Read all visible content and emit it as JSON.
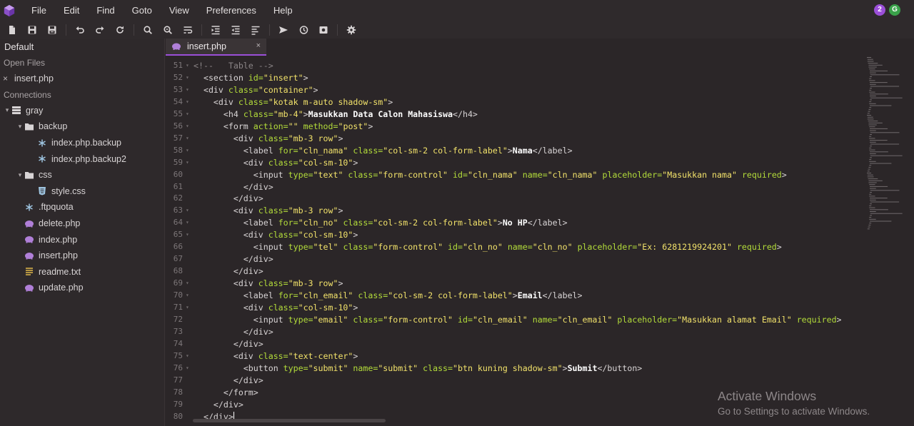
{
  "window": {
    "menu": [
      "File",
      "Edit",
      "Find",
      "Goto",
      "View",
      "Preferences",
      "Help"
    ],
    "badges": [
      {
        "label": "2",
        "color": "#9b4fd8"
      },
      {
        "label": "G",
        "color": "#3aa14a"
      }
    ]
  },
  "toolbar": {
    "icons": [
      "new-file-icon",
      "save-icon",
      "save-all-icon",
      "undo-icon",
      "redo-icon",
      "reload-icon",
      "search-icon",
      "search-replace-icon",
      "wrap-icon",
      "indent-icon",
      "outdent-icon",
      "format-icon",
      "send-icon",
      "history-icon",
      "preview-icon",
      "settings-icon"
    ]
  },
  "sidebar": {
    "title": "Default",
    "open_files_label": "Open Files",
    "open_files": [
      {
        "name": "insert.php",
        "close": "×"
      }
    ],
    "connections_label": "Connections",
    "tree": [
      {
        "label": "gray",
        "type": "server",
        "depth": 0,
        "caret": "▾"
      },
      {
        "label": "backup",
        "type": "folder",
        "depth": 1,
        "caret": "▾"
      },
      {
        "label": "index.php.backup",
        "type": "asterisk",
        "depth": 2
      },
      {
        "label": "index.php.backup2",
        "type": "asterisk",
        "depth": 2
      },
      {
        "label": "css",
        "type": "folder",
        "depth": 1,
        "caret": "▾"
      },
      {
        "label": "style.css",
        "type": "css",
        "depth": 2
      },
      {
        "label": ".ftpquota",
        "type": "asterisk",
        "depth": 1
      },
      {
        "label": "delete.php",
        "type": "php",
        "depth": 1
      },
      {
        "label": "index.php",
        "type": "php",
        "depth": 1
      },
      {
        "label": "insert.php",
        "type": "php",
        "depth": 1
      },
      {
        "label": "readme.txt",
        "type": "txt",
        "depth": 1
      },
      {
        "label": "update.php",
        "type": "php",
        "depth": 1
      }
    ]
  },
  "tab": {
    "label": "insert.php",
    "close": "×"
  },
  "editor": {
    "lines": [
      {
        "n": "51",
        "fold": "▾",
        "html": "<span class=\"cmt\">&lt;!--   Table --&gt;</span>"
      },
      {
        "n": "52",
        "fold": "▾",
        "html": "  <span class=\"tag\">&lt;section</span> <span class=\"attr\">id=</span><span class=\"str\">\"insert\"</span><span class=\"tag\">&gt;</span>"
      },
      {
        "n": "53",
        "fold": "▾",
        "html": "  <span class=\"tag\">&lt;div</span> <span class=\"attr\">class=</span><span class=\"str\">\"container\"</span><span class=\"tag\">&gt;</span>"
      },
      {
        "n": "54",
        "fold": "▾",
        "html": "    <span class=\"tag\">&lt;div</span> <span class=\"attr\">class=</span><span class=\"str\">\"kotak m-auto shadow-sm\"</span><span class=\"tag\">&gt;</span>"
      },
      {
        "n": "55",
        "fold": "▾",
        "html": "      <span class=\"tag\">&lt;h4</span> <span class=\"attr\">class=</span><span class=\"str\">\"mb-4\"</span><span class=\"tag\">&gt;</span><span class=\"txt\">Masukkan Data Calon Mahasiswa</span><span class=\"tag\">&lt;/h4&gt;</span>"
      },
      {
        "n": "56",
        "fold": "▾",
        "html": "      <span class=\"tag\">&lt;form</span> <span class=\"attr\">action=</span><span class=\"str\">\"\"</span> <span class=\"attr\">method=</span><span class=\"str\">\"post\"</span><span class=\"tag\">&gt;</span>"
      },
      {
        "n": "57",
        "fold": "▾",
        "html": "        <span class=\"tag\">&lt;div</span> <span class=\"attr\">class=</span><span class=\"str\">\"mb-3 row\"</span><span class=\"tag\">&gt;</span>"
      },
      {
        "n": "58",
        "fold": "▾",
        "html": "          <span class=\"tag\">&lt;label</span> <span class=\"attr\">for=</span><span class=\"str\">\"cln_nama\"</span> <span class=\"attr\">class=</span><span class=\"str\">\"col-sm-2 col-form-label\"</span><span class=\"tag\">&gt;</span><span class=\"txt\">Nama</span><span class=\"tag\">&lt;/label&gt;</span>"
      },
      {
        "n": "59",
        "fold": "▾",
        "html": "          <span class=\"tag\">&lt;div</span> <span class=\"attr\">class=</span><span class=\"str\">\"col-sm-10\"</span><span class=\"tag\">&gt;</span>"
      },
      {
        "n": "60",
        "fold": "",
        "html": "            <span class=\"tag\">&lt;input</span> <span class=\"attr\">type=</span><span class=\"str\">\"text\"</span> <span class=\"attr\">class=</span><span class=\"str\">\"form-control\"</span> <span class=\"attr\">id=</span><span class=\"str\">\"cln_nama\"</span> <span class=\"attr\">name=</span><span class=\"str\">\"cln_nama\"</span> <span class=\"attr\">placeholder=</span><span class=\"str\">\"Masukkan nama\"</span> <span class=\"attr\">required</span><span class=\"tag\">&gt;</span>"
      },
      {
        "n": "61",
        "fold": "",
        "html": "          <span class=\"tag\">&lt;/div&gt;</span>"
      },
      {
        "n": "62",
        "fold": "",
        "html": "        <span class=\"tag\">&lt;/div&gt;</span>"
      },
      {
        "n": "63",
        "fold": "▾",
        "html": "        <span class=\"tag\">&lt;div</span> <span class=\"attr\">class=</span><span class=\"str\">\"mb-3 row\"</span><span class=\"tag\">&gt;</span>"
      },
      {
        "n": "64",
        "fold": "▾",
        "html": "          <span class=\"tag\">&lt;label</span> <span class=\"attr\">for=</span><span class=\"str\">\"cln_no\"</span> <span class=\"attr\">class=</span><span class=\"str\">\"col-sm-2 col-form-label\"</span><span class=\"tag\">&gt;</span><span class=\"txt\">No HP</span><span class=\"tag\">&lt;/label&gt;</span>"
      },
      {
        "n": "65",
        "fold": "▾",
        "html": "          <span class=\"tag\">&lt;div</span> <span class=\"attr\">class=</span><span class=\"str\">\"col-sm-10\"</span><span class=\"tag\">&gt;</span>"
      },
      {
        "n": "66",
        "fold": "",
        "html": "            <span class=\"tag\">&lt;input</span> <span class=\"attr\">type=</span><span class=\"str\">\"tel\"</span> <span class=\"attr\">class=</span><span class=\"str\">\"form-control\"</span> <span class=\"attr\">id=</span><span class=\"str\">\"cln_no\"</span> <span class=\"attr\">name=</span><span class=\"str\">\"cln_no\"</span> <span class=\"attr\">placeholder=</span><span class=\"str\">\"Ex: 6281219924201\"</span> <span class=\"attr\">required</span><span class=\"tag\">&gt;</span>"
      },
      {
        "n": "67",
        "fold": "",
        "html": "          <span class=\"tag\">&lt;/div&gt;</span>"
      },
      {
        "n": "68",
        "fold": "",
        "html": "        <span class=\"tag\">&lt;/div&gt;</span>"
      },
      {
        "n": "69",
        "fold": "▾",
        "html": "        <span class=\"tag\">&lt;div</span> <span class=\"attr\">class=</span><span class=\"str\">\"mb-3 row\"</span><span class=\"tag\">&gt;</span>"
      },
      {
        "n": "70",
        "fold": "▾",
        "html": "          <span class=\"tag\">&lt;label</span> <span class=\"attr\">for=</span><span class=\"str\">\"cln_email\"</span> <span class=\"attr\">class=</span><span class=\"str\">\"col-sm-2 col-form-label\"</span><span class=\"tag\">&gt;</span><span class=\"txt\">Email</span><span class=\"tag\">&lt;/label&gt;</span>"
      },
      {
        "n": "71",
        "fold": "▾",
        "html": "          <span class=\"tag\">&lt;div</span> <span class=\"attr\">class=</span><span class=\"str\">\"col-sm-10\"</span><span class=\"tag\">&gt;</span>"
      },
      {
        "n": "72",
        "fold": "",
        "html": "            <span class=\"tag\">&lt;input</span> <span class=\"attr\">type=</span><span class=\"str\">\"email\"</span> <span class=\"attr\">class=</span><span class=\"str\">\"form-control\"</span> <span class=\"attr\">id=</span><span class=\"str\">\"cln_email\"</span> <span class=\"attr\">name=</span><span class=\"str\">\"cln_email\"</span> <span class=\"attr\">placeholder=</span><span class=\"str\">\"Masukkan alamat Email\"</span> <span class=\"attr\">required</span><span class=\"tag\">&gt;</span>"
      },
      {
        "n": "73",
        "fold": "",
        "html": "          <span class=\"tag\">&lt;/div&gt;</span>"
      },
      {
        "n": "74",
        "fold": "",
        "html": "        <span class=\"tag\">&lt;/div&gt;</span>"
      },
      {
        "n": "75",
        "fold": "▾",
        "html": "        <span class=\"tag\">&lt;div</span> <span class=\"attr\">class=</span><span class=\"str\">\"text-center\"</span><span class=\"tag\">&gt;</span>"
      },
      {
        "n": "76",
        "fold": "▾",
        "html": "          <span class=\"tag\">&lt;button</span> <span class=\"attr\">type=</span><span class=\"str\">\"submit\"</span> <span class=\"attr\">name=</span><span class=\"str\">\"submit\"</span> <span class=\"attr\">class=</span><span class=\"str\">\"btn kuning shadow-sm\"</span><span class=\"tag\">&gt;</span><span class=\"txt\">Submit</span><span class=\"tag\">&lt;/button&gt;</span>"
      },
      {
        "n": "77",
        "fold": "",
        "html": "        <span class=\"tag\">&lt;/div&gt;</span>"
      },
      {
        "n": "78",
        "fold": "",
        "html": "      <span class=\"tag\">&lt;/form&gt;</span>"
      },
      {
        "n": "79",
        "fold": "",
        "html": "    <span class=\"tag\">&lt;/div&gt;</span>"
      },
      {
        "n": "80",
        "fold": "",
        "html": "  <span class=\"tag\">&lt;/div&gt;</span><span class=\"cursor\"></span>"
      }
    ]
  },
  "overlay": {
    "title": "Activate Windows",
    "subtitle": "Go to Settings to activate Windows."
  }
}
